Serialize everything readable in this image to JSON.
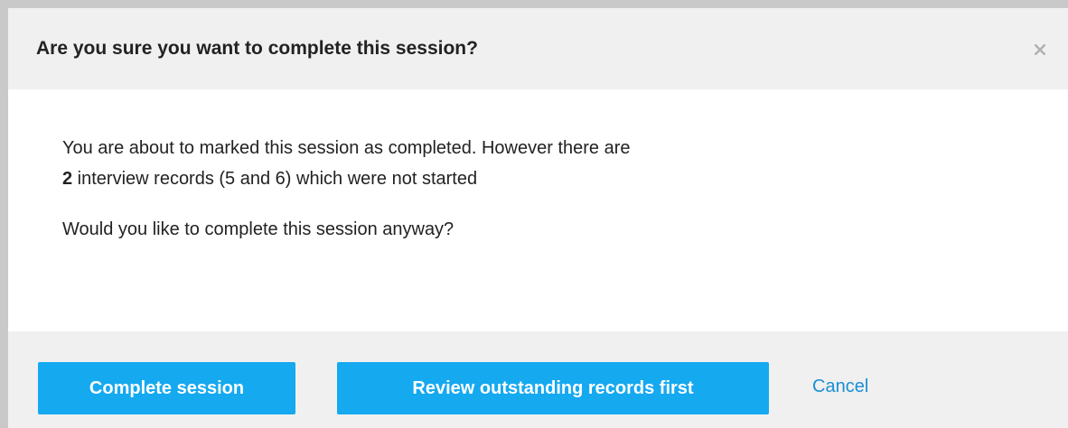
{
  "dialog": {
    "title": "Are you sure you want to complete this session?",
    "close_icon": "close-icon",
    "body": {
      "line1": "You are about to marked this session as completed. However there are",
      "line2_count": "2",
      "line2_rest": " interview records (5 and 6) which were not started",
      "line3": "Would you like to complete this session anyway?"
    },
    "footer": {
      "complete_label": "Complete session",
      "review_label": "Review outstanding records first",
      "cancel_label": "Cancel"
    }
  },
  "colors": {
    "primary_button": "#15a9f0",
    "link": "#1a8fd4",
    "header_bg": "#f0f0f0",
    "frame": "#c9c9c9"
  }
}
